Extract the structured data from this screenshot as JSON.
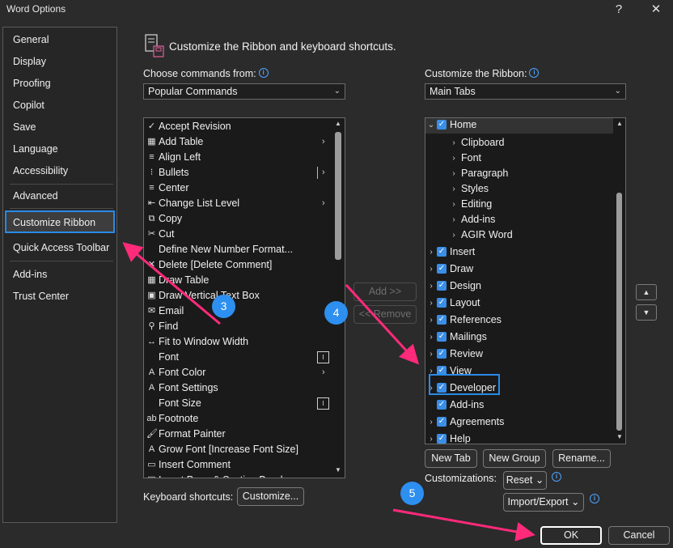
{
  "window": {
    "title": "Word Options",
    "help_glyph": "?",
    "close_glyph": "✕"
  },
  "nav": {
    "items": [
      {
        "label": "General"
      },
      {
        "label": "Display"
      },
      {
        "label": "Proofing"
      },
      {
        "label": "Copilot"
      },
      {
        "label": "Save"
      },
      {
        "label": "Language"
      },
      {
        "label": "Accessibility"
      },
      {
        "label": "Advanced"
      },
      {
        "label": "Customize Ribbon"
      },
      {
        "label": "Quick Access Toolbar"
      },
      {
        "label": "Add-ins"
      },
      {
        "label": "Trust Center"
      }
    ],
    "selected": "Customize Ribbon"
  },
  "heading": "Customize the Ribbon and keyboard shortcuts.",
  "commands": {
    "label": "Choose commands from:",
    "selected": "Popular Commands",
    "items": [
      {
        "label": "Accept Revision",
        "icon": "accept-revision-icon",
        "glyph": "✓"
      },
      {
        "label": "Add Table",
        "icon": "table-icon",
        "glyph": "▦",
        "sub": "›"
      },
      {
        "label": "Align Left",
        "icon": "align-left-icon",
        "glyph": "≡"
      },
      {
        "label": "Bullets",
        "icon": "bullets-icon",
        "glyph": "⁝",
        "sub": "›"
      },
      {
        "label": "Center",
        "icon": "center-icon",
        "glyph": "≡"
      },
      {
        "label": "Change List Level",
        "icon": "list-level-icon",
        "glyph": "⇤",
        "sub": "›"
      },
      {
        "label": "Copy",
        "icon": "copy-icon",
        "glyph": "⧉"
      },
      {
        "label": "Cut",
        "icon": "scissors-icon",
        "glyph": "✂"
      },
      {
        "label": "Define New Number Format...",
        "icon": "",
        "glyph": ""
      },
      {
        "label": "Delete [Delete Comment]",
        "icon": "delete-comment-icon",
        "glyph": "✕"
      },
      {
        "label": "Draw Table",
        "icon": "draw-table-icon",
        "glyph": "▦"
      },
      {
        "label": "Draw Vertical Text Box",
        "icon": "text-box-icon",
        "glyph": "▣"
      },
      {
        "label": "Email",
        "icon": "email-icon",
        "glyph": "✉"
      },
      {
        "label": "Find",
        "icon": "search-icon",
        "glyph": "⚲"
      },
      {
        "label": "Fit to Window Width",
        "icon": "fit-width-icon",
        "glyph": "↔"
      },
      {
        "label": "Font",
        "icon": "",
        "glyph": "",
        "dropdown": "I"
      },
      {
        "label": "Font Color",
        "icon": "font-color-icon",
        "glyph": "A",
        "sub": "›"
      },
      {
        "label": "Font Settings",
        "icon": "font-settings-icon",
        "glyph": "A"
      },
      {
        "label": "Font Size",
        "icon": "",
        "glyph": "",
        "dropdown": "I"
      },
      {
        "label": "Footnote",
        "icon": "footnote-icon",
        "glyph": "ab"
      },
      {
        "label": "Format Painter",
        "icon": "format-painter-icon",
        "glyph": "🖌"
      },
      {
        "label": "Grow Font [Increase Font Size]",
        "icon": "grow-font-icon",
        "glyph": "A"
      },
      {
        "label": "Insert Comment",
        "icon": "insert-comment-icon",
        "glyph": "▭"
      },
      {
        "label": "Insert Page & Section Breaks",
        "icon": "page-break-icon",
        "glyph": "▤"
      }
    ]
  },
  "ribbon": {
    "label": "Customize the Ribbon:",
    "selected": "Main Tabs",
    "tree": [
      {
        "label": "Home",
        "level": 0,
        "expander": "⌄",
        "checked": true
      },
      {
        "label": "Clipboard",
        "level": 1,
        "expander": "›"
      },
      {
        "label": "Font",
        "level": 1,
        "expander": "›"
      },
      {
        "label": "Paragraph",
        "level": 1,
        "expander": "›"
      },
      {
        "label": "Styles",
        "level": 1,
        "expander": "›"
      },
      {
        "label": "Editing",
        "level": 1,
        "expander": "›"
      },
      {
        "label": "Add-ins",
        "level": 1,
        "expander": "›"
      },
      {
        "label": "AGIR Word",
        "level": 1,
        "expander": "›"
      },
      {
        "label": "Insert",
        "level": 0,
        "expander": "›",
        "checked": true
      },
      {
        "label": "Draw",
        "level": 0,
        "expander": "›",
        "checked": true
      },
      {
        "label": "Design",
        "level": 0,
        "expander": "›",
        "checked": true
      },
      {
        "label": "Layout",
        "level": 0,
        "expander": "›",
        "checked": true
      },
      {
        "label": "References",
        "level": 0,
        "expander": "›",
        "checked": true
      },
      {
        "label": "Mailings",
        "level": 0,
        "expander": "›",
        "checked": true
      },
      {
        "label": "Review",
        "level": 0,
        "expander": "›",
        "checked": true
      },
      {
        "label": "View",
        "level": 0,
        "expander": "›",
        "checked": true
      },
      {
        "label": "Developer",
        "level": 0,
        "expander": "›",
        "checked": true
      },
      {
        "label": "Add-ins",
        "level": 0,
        "expander": "",
        "checked": true
      },
      {
        "label": "Agreements",
        "level": 0,
        "expander": "›",
        "checked": true
      },
      {
        "label": "Help",
        "level": 0,
        "expander": "›",
        "checked": true
      }
    ]
  },
  "buttons": {
    "add": "Add >>",
    "remove": "<< Remove",
    "new_tab": "New Tab",
    "new_group": "New Group",
    "rename": "Rename...",
    "reset": "Reset ⌄",
    "import_export": "Import/Export ⌄",
    "customize": "Customize...",
    "ok": "OK",
    "cancel": "Cancel"
  },
  "customizations_label": "Customizations:",
  "keyboard_shortcuts_label": "Keyboard shortcuts:",
  "annotations": {
    "step3": "3",
    "step4": "4",
    "step5": "5"
  },
  "colors": {
    "accent": "#2a8ae6",
    "annotation_arrow": "#ff2a7a",
    "background": "#2b2b2b"
  }
}
